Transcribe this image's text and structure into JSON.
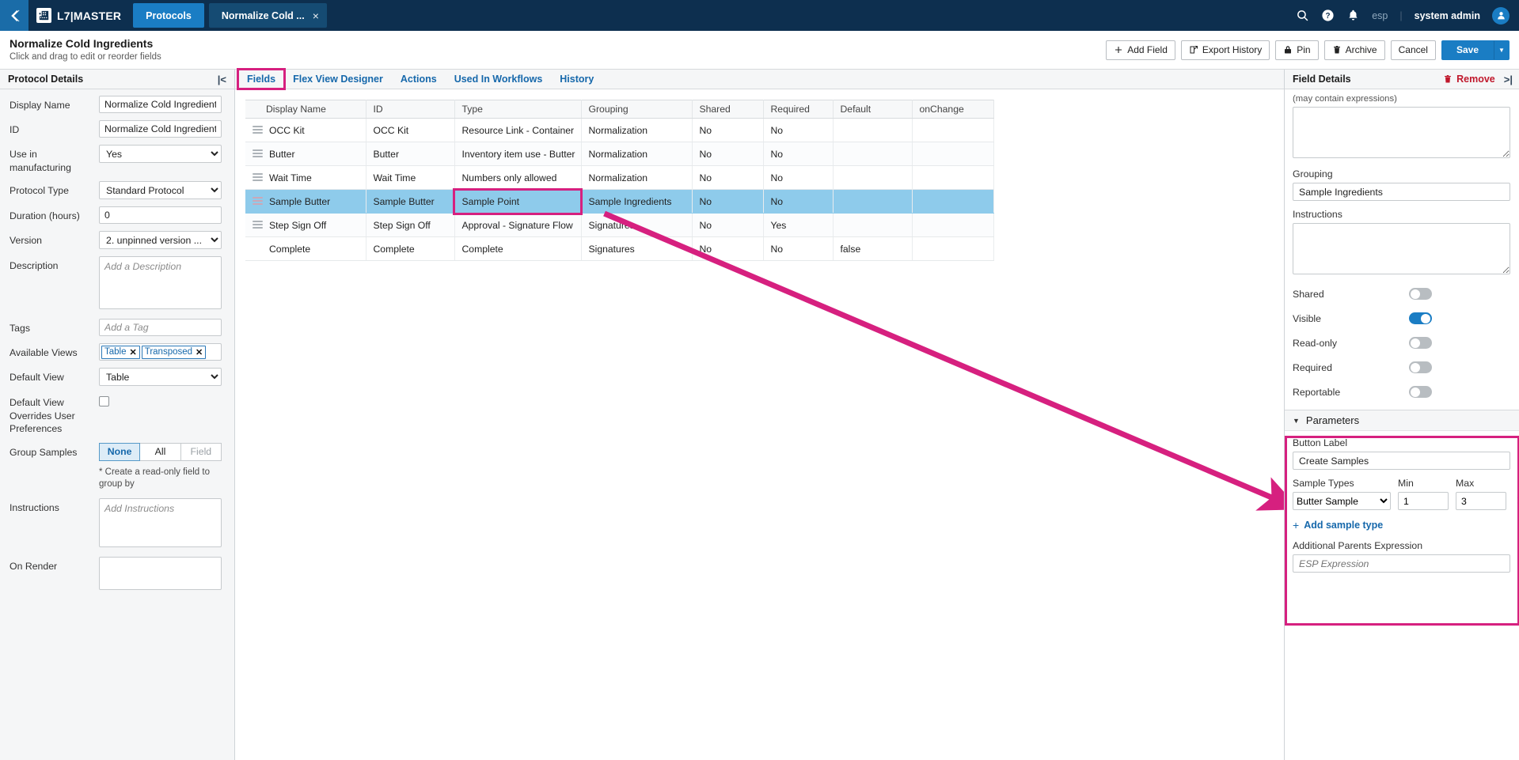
{
  "topnav": {
    "back_icon": "chevron-left-icon",
    "brand": "L7|MASTER",
    "brand_logo_icon": "app-grid-icon",
    "tabs": [
      {
        "label": "Protocols",
        "style": "primary"
      },
      {
        "label": "Normalize Cold ...",
        "style": "doc",
        "close": "×"
      }
    ],
    "search_icon": "search-icon",
    "help_icon": "help-circle-icon",
    "bell_icon": "notification-bell-icon",
    "tenant": "esp",
    "separator": "|",
    "user": "system admin",
    "avatar_icon": "user-avatar-icon"
  },
  "page_header": {
    "title": "Normalize Cold Ingredients",
    "subtitle": "Click and drag to edit or reorder fields",
    "buttons": [
      {
        "label": "Add Field",
        "icon": "plus-icon"
      },
      {
        "label": "Export History",
        "icon": "external-link-icon"
      },
      {
        "label": "Pin",
        "icon": "lock-icon"
      },
      {
        "label": "Archive",
        "icon": "trash-icon"
      },
      {
        "label": "Cancel",
        "icon": ""
      }
    ],
    "save_label": "Save",
    "save_caret_icon": "chevron-down-icon"
  },
  "left_panel": {
    "title": "Protocol Details",
    "collapse_icon": "collapse-left-icon",
    "fields": {
      "display_name_label": "Display Name",
      "display_name_value": "Normalize Cold Ingredient",
      "id_label": "ID",
      "id_value": "Normalize Cold Ingredient",
      "use_in_manufacturing_label": "Use in manufacturing",
      "use_in_manufacturing_value": "Yes",
      "protocol_type_label": "Protocol Type",
      "protocol_type_value": "Standard Protocol",
      "duration_label": "Duration (hours)",
      "duration_value": "0",
      "version_label": "Version",
      "version_value": "2. unpinned version ...",
      "description_label": "Description",
      "description_placeholder": "Add a Description",
      "tags_label": "Tags",
      "tags_placeholder": "Add a Tag",
      "available_views_label": "Available Views",
      "available_views_chips": [
        "Table",
        "Transposed"
      ],
      "chip_remove_icon": "✕",
      "default_view_label": "Default View",
      "default_view_value": "Table",
      "default_view_overrides_label": "Default View Overrides User Preferences",
      "group_samples_label": "Group Samples",
      "group_samples_options": [
        "None",
        "All",
        "Field"
      ],
      "group_samples_selected": "None",
      "group_samples_hint": "* Create a read-only field to group by",
      "instructions_label": "Instructions",
      "instructions_placeholder": "Add Instructions",
      "on_render_label": "On Render",
      "on_render_value": ""
    }
  },
  "center": {
    "tabs": [
      {
        "label": "Fields",
        "selected": true
      },
      {
        "label": "Flex View Designer",
        "selected": false
      },
      {
        "label": "Actions",
        "selected": false
      },
      {
        "label": "Used In Workflows",
        "selected": false
      },
      {
        "label": "History",
        "selected": false
      }
    ],
    "table": {
      "columns": [
        "Display Name",
        "ID",
        "Type",
        "Grouping",
        "Shared",
        "Required",
        "Default",
        "onChange"
      ],
      "rows": [
        {
          "display_name": "OCC Kit",
          "id": "OCC Kit",
          "type": "Resource Link - Container",
          "grouping": "Normalization",
          "shared": "No",
          "required": "No",
          "default": "",
          "onchange": "",
          "selected": false
        },
        {
          "display_name": "Butter",
          "id": "Butter",
          "type": "Inventory item use - Butter",
          "grouping": "Normalization",
          "shared": "No",
          "required": "No",
          "default": "",
          "onchange": "",
          "selected": false
        },
        {
          "display_name": "Wait Time",
          "id": "Wait Time",
          "type": "Numbers only allowed",
          "grouping": "Normalization",
          "shared": "No",
          "required": "No",
          "default": "",
          "onchange": "",
          "selected": false
        },
        {
          "display_name": "Sample Butter",
          "id": "Sample Butter",
          "type": "Sample Point",
          "grouping": "Sample Ingredients",
          "shared": "No",
          "required": "No",
          "default": "",
          "onchange": "",
          "selected": true
        },
        {
          "display_name": "Step Sign Off",
          "id": "Step Sign Off",
          "type": "Approval - Signature Flow",
          "grouping": "Signatures",
          "shared": "No",
          "required": "Yes",
          "default": "",
          "onchange": "",
          "selected": false
        },
        {
          "display_name": "Complete",
          "id": "Complete",
          "type": "Complete",
          "grouping": "Signatures",
          "shared": "No",
          "required": "No",
          "default": "false",
          "onchange": "",
          "selected": false
        }
      ]
    }
  },
  "right_panel": {
    "title": "Field Details",
    "remove_label": "Remove",
    "remove_icon": "trash-icon",
    "expand_icon": "expand-right-icon",
    "expressions_note": "(may contain expressions)",
    "grouping_label": "Grouping",
    "grouping_value": "Sample Ingredients",
    "instructions_label": "Instructions",
    "instructions_value": "",
    "toggles": [
      {
        "label": "Shared",
        "on": false
      },
      {
        "label": "Visible",
        "on": true
      },
      {
        "label": "Read-only",
        "on": false
      },
      {
        "label": "Required",
        "on": false
      },
      {
        "label": "Reportable",
        "on": false
      }
    ],
    "parameters": {
      "section_title": "Parameters",
      "caret_icon": "caret-down-icon",
      "button_label_label": "Button Label",
      "button_label_value": "Create Samples",
      "sample_types_label": "Sample Types",
      "min_label": "Min",
      "max_label": "Max",
      "sample_type_value": "Butter Sample",
      "min_value": "1",
      "max_value": "3",
      "remove_row_icon": "✕",
      "add_sample_type_label": "Add sample type",
      "add_icon": "plus-icon",
      "additional_parents_label": "Additional Parents Expression",
      "additional_parents_placeholder": "ESP Expression"
    }
  },
  "annotations": {
    "highlight_color": "#d6207f",
    "arrow_from": "type-cell-sample-point",
    "arrow_to": "parameters-section"
  }
}
